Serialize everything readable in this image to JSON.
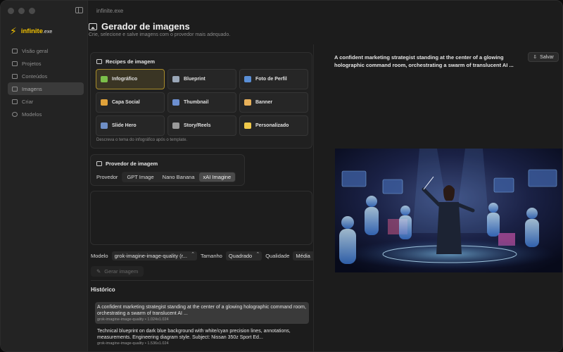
{
  "app": {
    "window_title": "infinite.exe",
    "brand_name": "infinite",
    "brand_suffix": ".exe"
  },
  "sidebar": {
    "items": [
      {
        "label": "Visão geral",
        "active": false
      },
      {
        "label": "Projetos",
        "active": false
      },
      {
        "label": "Conteúdos",
        "active": false
      },
      {
        "label": "Imagens",
        "active": true
      },
      {
        "label": "Criar",
        "active": false
      },
      {
        "label": "Modelos",
        "active": false
      }
    ]
  },
  "page": {
    "title": "Gerador de imagens",
    "subtitle": "Crie, selecione e salve imagens com o provedor mais adequado."
  },
  "recipes": {
    "title": "Recipes de imagem",
    "hint": "Descreva o tema do infográfico após o template.",
    "items": [
      {
        "label": "Infográfico",
        "icon": "chart-icon",
        "color": "#7bbf4a",
        "selected": true
      },
      {
        "label": "Blueprint",
        "icon": "triangle-ruler-icon",
        "color": "#9aa7b8",
        "selected": false
      },
      {
        "label": "Foto de Perfil",
        "icon": "person-icon",
        "color": "#5a8fd6",
        "selected": false
      },
      {
        "label": "Capa Social",
        "icon": "bar-chart-icon",
        "color": "#e0a23a",
        "selected": false
      },
      {
        "label": "Thumbnail",
        "icon": "play-icon",
        "color": "#6d8fd0",
        "selected": false
      },
      {
        "label": "Banner",
        "icon": "ticket-icon",
        "color": "#e8b15a",
        "selected": false
      },
      {
        "label": "Slide Hero",
        "icon": "stats-icon",
        "color": "#6f8fc6",
        "selected": false
      },
      {
        "label": "Story/Reels",
        "icon": "phone-icon",
        "color": "#9a9a9a",
        "selected": false
      },
      {
        "label": "Personalizado",
        "icon": "sparkles-icon",
        "color": "#f0c94a",
        "selected": false
      }
    ]
  },
  "provider": {
    "title": "Provedor de imagem",
    "label": "Provedor",
    "options": [
      "GPT Image",
      "Nano Banana",
      "xAI Imagine"
    ],
    "selected": "xAI Imagine"
  },
  "controls": {
    "model_label": "Modelo",
    "model_value": "grok-imagine-image-quality (r...",
    "size_label": "Tamanho",
    "size_value": "Quadrado",
    "quality_label": "Qualidade",
    "quality_value": "Média",
    "generate_label": "Gerar imagem"
  },
  "history": {
    "title": "Histórico",
    "items": [
      {
        "text": "A confident marketing strategist standing at the center of a glowing holographic command room, orchestrating a swarm of translucent AI ...",
        "meta": "grok-imagine-image-quality • 1.024x1.024",
        "active": true
      },
      {
        "text": "Technical blueprint on dark blue background with white/cyan precision lines, annotations, measurements. Engineering diagram style. Subject: Nissan 350z Sport Ed...",
        "meta": "grok-imagine-image-quality • 1.536x1.024",
        "active": false
      },
      {
        "text": "Technical blueprint on dark blue background with white/cyan precision lines",
        "meta": "",
        "active": false
      }
    ]
  },
  "preview": {
    "prompt": "A confident marketing strategist standing at the center of a glowing holographic command room, orchestrating a swarm of translucent AI ...",
    "save_label": "Salvar"
  }
}
